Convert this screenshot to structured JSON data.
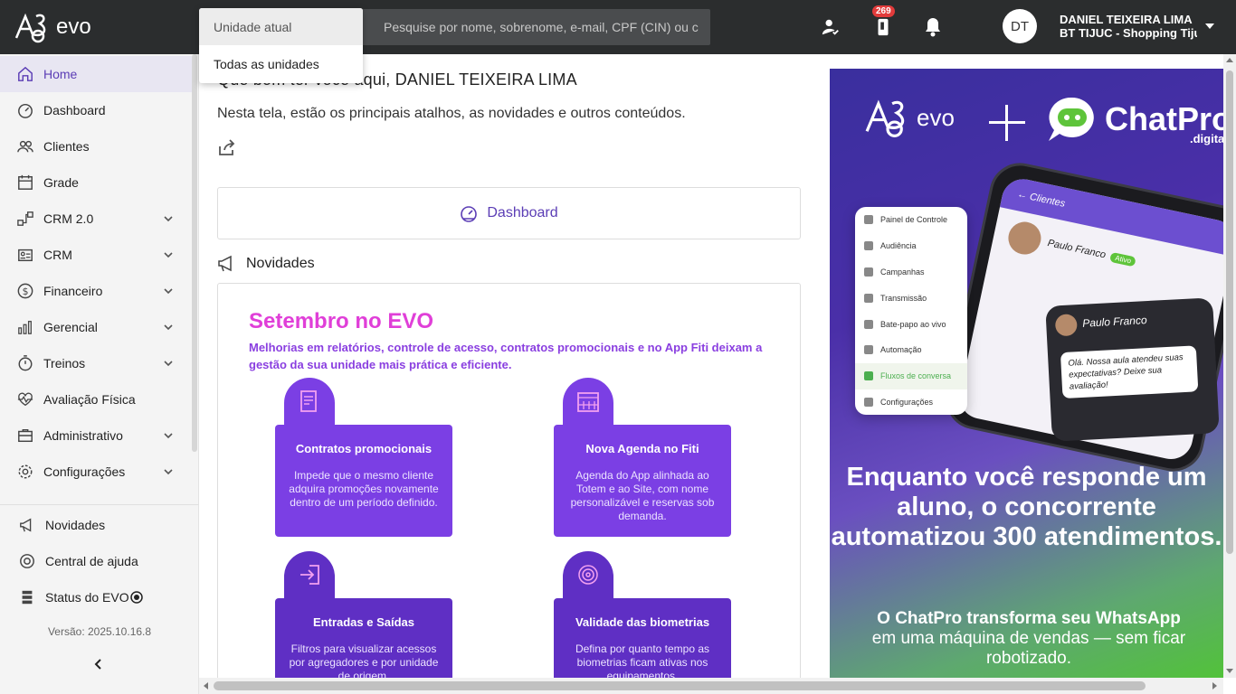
{
  "header": {
    "logo_text": "evo",
    "search_placeholder": "Pesquise por nome, sobrenome, e-mail, CPF (CIN) ou c",
    "notification_badge": "269",
    "avatar_initials": "DT",
    "user_name": "DANIEL TEIXEIRA LIMA",
    "unit_name": "BT TIJUC - Shopping Tijuca"
  },
  "scope_dropdown": {
    "options": [
      "Unidade atual",
      "Todas as unidades"
    ],
    "selected": "Unidade atual"
  },
  "sidebar": {
    "items": [
      {
        "label": "Home",
        "icon": "home-icon",
        "active": true,
        "expandable": false
      },
      {
        "label": "Dashboard",
        "icon": "speedometer-icon",
        "active": false,
        "expandable": false
      },
      {
        "label": "Clientes",
        "icon": "users-icon",
        "active": false,
        "expandable": false
      },
      {
        "label": "Grade",
        "icon": "calendar-icon",
        "active": false,
        "expandable": false
      },
      {
        "label": "CRM 2.0",
        "icon": "crm-flow-icon",
        "active": false,
        "expandable": true
      },
      {
        "label": "CRM",
        "icon": "id-card-icon",
        "active": false,
        "expandable": true
      },
      {
        "label": "Financeiro",
        "icon": "dollar-icon",
        "active": false,
        "expandable": true
      },
      {
        "label": "Gerencial",
        "icon": "bar-chart-icon",
        "active": false,
        "expandable": true
      },
      {
        "label": "Treinos",
        "icon": "stopwatch-icon",
        "active": false,
        "expandable": true
      },
      {
        "label": "Avaliação Física",
        "icon": "heartbeat-icon",
        "active": false,
        "expandable": false
      },
      {
        "label": "Administrativo",
        "icon": "briefcase-icon",
        "active": false,
        "expandable": true
      },
      {
        "label": "Configurações",
        "icon": "gear-icon",
        "active": false,
        "expandable": true
      }
    ],
    "footer": [
      {
        "label": "Novidades",
        "icon": "megaphone-icon"
      },
      {
        "label": "Central de ajuda",
        "icon": "lifebuoy-icon"
      },
      {
        "label": "Status do EVO",
        "icon": "server-icon"
      }
    ],
    "version": "Versão: 2025.10.16.8"
  },
  "main": {
    "welcome": "Que bom ter você aqui, DANIEL TEIXEIRA LIMA",
    "subtitle": "Nesta tela, estão os principais atalhos, as novidades e outros conteúdos.",
    "dashboard_shortcut": "Dashboard",
    "news_title": "Novidades",
    "news_card": {
      "title": "Setembro no EVO",
      "subtitle": "Melhorias em relatórios, controle de acesso, contratos promocionais e no App Fiti deixam a gestão da sua unidade mais prática e eficiente.",
      "features": [
        {
          "title": "Contratos promocionais",
          "desc": "Impede que o mesmo cliente adquira promoções novamente dentro de um período definido."
        },
        {
          "title": "Nova Agenda no Fiti",
          "desc": "Agenda do App alinhada ao Totem e ao Site, com nome personalizável e reservas sob demanda."
        },
        {
          "title": "Entradas e Saídas",
          "desc": "Filtros para visualizar acessos por agregadores e por unidade de origem."
        },
        {
          "title": "Validade das biometrias",
          "desc": "Defina por quanto tempo as biometrias ficam ativas nos equipamentos."
        }
      ]
    }
  },
  "banner": {
    "evo_text": "evo",
    "chatpro_text": "ChatPro",
    "chatpro_domain": ".digital",
    "app_header": "Clientes",
    "contact_name": "Paulo Franco",
    "contact_status": "Ativo",
    "menu_items": [
      "Painel de Controle",
      "Audiência",
      "Campanhas",
      "Transmissão",
      "Bate-papo ao vivo",
      "Automação",
      "Fluxos de conversa",
      "Configurações"
    ],
    "menu_highlight": "Fluxos de conversa",
    "chat_name": "Paulo Franco",
    "chat_message": "Olá. Nossa aula atendeu suas expectativas? Deixe sua avaliação!",
    "headline": "Enquanto você responde um aluno, o concorrente automatizou 300 atendimentos.",
    "tagline_bold": "O ChatPro transforma seu WhatsApp",
    "tagline_rest": "em uma máquina de vendas — sem ficar robotizado."
  }
}
